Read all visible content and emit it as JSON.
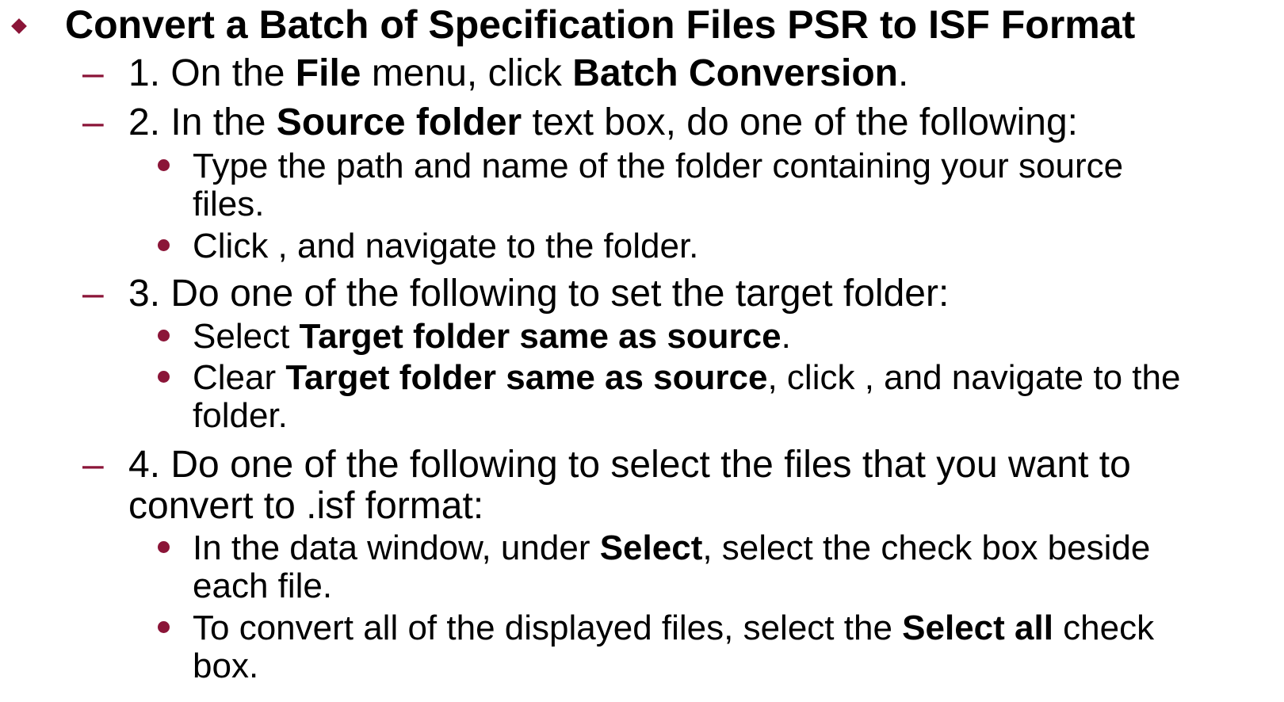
{
  "heading": "Convert a Batch of Specification Files PSR to ISF Format",
  "accent_color": "#8b1538",
  "steps": [
    {
      "number": "1.",
      "parts": [
        {
          "t": " On the "
        },
        {
          "b": "File"
        },
        {
          "t": " menu, click "
        },
        {
          "b": "Batch Conversion"
        },
        {
          "t": "."
        }
      ]
    },
    {
      "number": "2.",
      "parts": [
        {
          "t": " In the "
        },
        {
          "b": "Source folder"
        },
        {
          "t": " text box, do one of the following:"
        }
      ],
      "bullets": [
        {
          "lines": [
            "Type the path and name of the folder containing your source",
            "files."
          ]
        },
        {
          "lines": [
            "Click , and navigate to the folder."
          ]
        }
      ]
    },
    {
      "number": "3.",
      "parts": [
        {
          "t": " Do one of the following to set the target folder:"
        }
      ],
      "bullets": [
        {
          "parts": [
            {
              "t": "Select "
            },
            {
              "b": "Target folder same as source"
            },
            {
              "t": "."
            }
          ]
        },
        {
          "parts": [
            {
              "t": "Clear "
            },
            {
              "b": "Target folder same as source"
            },
            {
              "t": ", click , and navigate to the"
            }
          ],
          "continuation": "folder."
        }
      ]
    },
    {
      "number": "4.",
      "lines": [
        "Do one of the following to select the files that you want to",
        "convert to .isf format:"
      ],
      "bullets": [
        {
          "parts": [
            {
              "t": "In the data window, under "
            },
            {
              "b": "Select"
            },
            {
              "t": ", select the check box beside"
            }
          ],
          "continuation": "each file."
        },
        {
          "parts": [
            {
              "t": "To convert all of the displayed files, select the "
            },
            {
              "b": "Select all"
            },
            {
              "t": " check"
            }
          ],
          "continuation": "box."
        }
      ]
    }
  ]
}
